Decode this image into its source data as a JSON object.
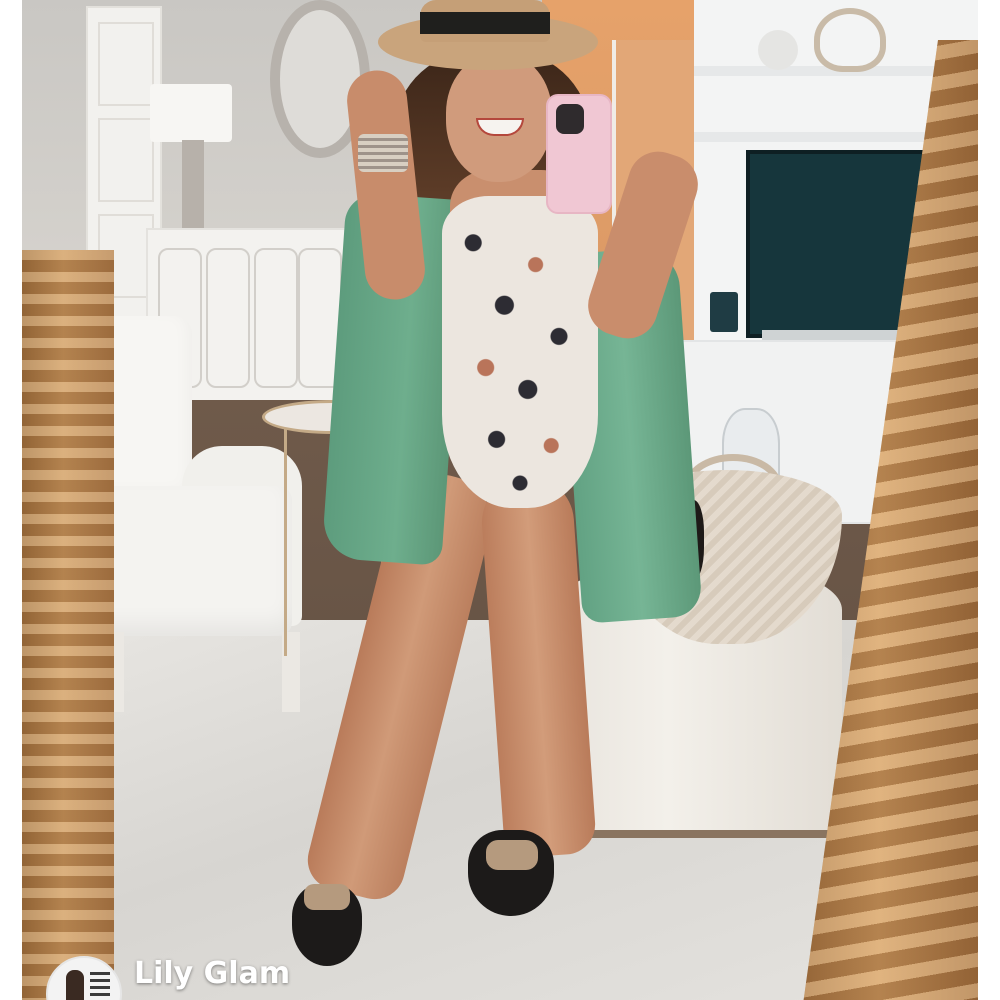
{
  "post": {
    "author_name": "Lily Glam"
  },
  "colors": {
    "cardigan": "#6eae8d",
    "mirror_frame_gold": "#c8945c",
    "hat_straw": "#c9a47c",
    "phone_case": "#f0c7d3"
  }
}
